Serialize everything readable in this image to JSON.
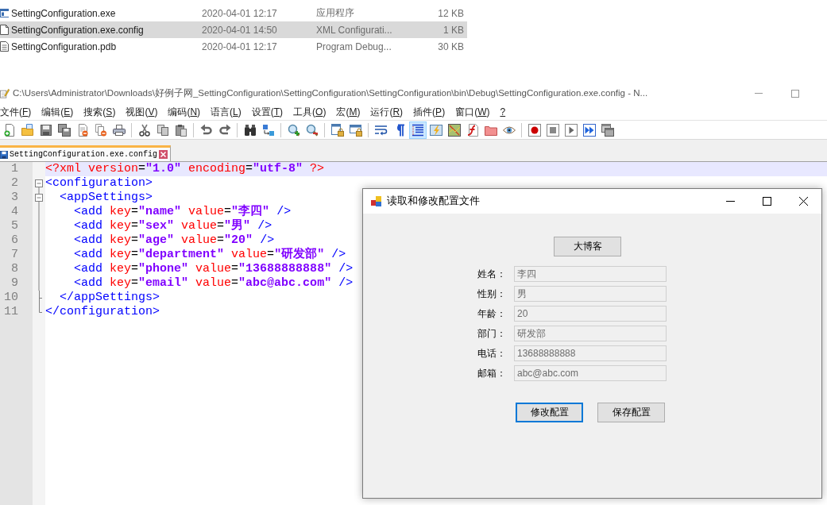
{
  "file_list": {
    "rows": [
      {
        "kind": "exe",
        "name": "SettingConfiguration.exe",
        "modified": "2020-04-01 12:17",
        "type": "应用程序",
        "size": "12 KB",
        "selected": false
      },
      {
        "kind": "config",
        "name": "SettingConfiguration.exe.config",
        "modified": "2020-04-01 14:50",
        "type": "XML Configurati...",
        "size": "1 KB",
        "selected": true
      },
      {
        "kind": "pdb",
        "name": "SettingConfiguration.pdb",
        "modified": "2020-04-01 12:17",
        "type": "Program Debug...",
        "size": "30 KB",
        "selected": false
      }
    ]
  },
  "editor_window": {
    "title": "C:\\Users\\Administrator\\Downloads\\好例子网_SettingConfiguration\\SettingConfiguration\\SettingConfiguration\\bin\\Debug\\SettingConfiguration.exe.config - N...",
    "menu": [
      "文件(F)",
      "编辑(E)",
      "搜索(S)",
      "视图(V)",
      "编码(N)",
      "语言(L)",
      "设置(T)",
      "工具(O)",
      "宏(M)",
      "运行(R)",
      "插件(P)",
      "窗口(W)",
      "?"
    ],
    "toolbar": [
      {
        "buttons": [
          {
            "selected": false
          },
          {
            "selected": false
          },
          {
            "selected": false
          },
          {
            "selected": false
          },
          {
            "selected": false
          },
          {
            "selected": false
          },
          {
            "selected": false
          }
        ]
      },
      {
        "buttons": [
          {
            "selected": false
          },
          {
            "selected": false
          },
          {
            "selected": false
          }
        ]
      },
      {
        "buttons": [
          {
            "selected": false
          },
          {
            "selected": false
          }
        ]
      },
      {
        "buttons": [
          {
            "selected": false
          },
          {
            "selected": false
          }
        ]
      },
      {
        "buttons": [
          {
            "selected": false
          },
          {
            "selected": false
          }
        ]
      },
      {
        "buttons": [
          {
            "selected": false
          },
          {
            "selected": false
          }
        ]
      },
      {
        "buttons": [
          {
            "selected": false
          },
          {
            "selected": false
          },
          {
            "selected": true
          },
          {
            "selected": false
          },
          {
            "selected": false
          },
          {
            "selected": false
          },
          {
            "selected": false
          },
          {
            "selected": false
          }
        ]
      },
      {
        "buttons": [
          {
            "selected": false
          },
          {
            "selected": false
          },
          {
            "selected": false
          },
          {
            "selected": false
          },
          {
            "selected": false
          }
        ]
      }
    ],
    "tabs": [
      {
        "label": "SettingConfiguration.exe.config",
        "selected": true,
        "modified": false
      }
    ],
    "lines": [
      {
        "number": "1",
        "current": true,
        "kind": "plain",
        "tokens": [
          {
            "kind": "pi",
            "text": "<?xml"
          },
          {
            "kind": "attr",
            "text": " version"
          },
          {
            "kind": "punct",
            "text": "="
          },
          {
            "kind": "value",
            "text": "\"1.0\""
          },
          {
            "kind": "attr",
            "text": " encoding"
          },
          {
            "kind": "punct",
            "text": "="
          },
          {
            "kind": "value",
            "text": "\"utf-8\""
          },
          {
            "kind": "pi",
            "text": " ?>"
          }
        ]
      },
      {
        "number": "2",
        "current": false,
        "kind": "head",
        "tokens": [
          {
            "kind": "tag",
            "text": "<configuration>"
          }
        ]
      },
      {
        "number": "3",
        "current": false,
        "kind": "subhead",
        "tokens": [
          {
            "kind": "tag",
            "text": "  <appSettings>"
          }
        ]
      },
      {
        "number": "4",
        "current": false,
        "kind": "body",
        "tokens": [
          {
            "kind": "tag",
            "text": "    <add"
          },
          {
            "kind": "attr",
            "text": " key"
          },
          {
            "kind": "punct",
            "text": "="
          },
          {
            "kind": "value",
            "text": "\"name\""
          },
          {
            "kind": "attr",
            "text": " value"
          },
          {
            "kind": "punct",
            "text": "="
          },
          {
            "kind": "value",
            "text": "\"李四\""
          },
          {
            "kind": "tag",
            "text": " />"
          }
        ]
      },
      {
        "number": "5",
        "current": false,
        "kind": "body",
        "tokens": [
          {
            "kind": "tag",
            "text": "    <add"
          },
          {
            "kind": "attr",
            "text": " key"
          },
          {
            "kind": "punct",
            "text": "="
          },
          {
            "kind": "value",
            "text": "\"sex\""
          },
          {
            "kind": "attr",
            "text": " value"
          },
          {
            "kind": "punct",
            "text": "="
          },
          {
            "kind": "value",
            "text": "\"男\""
          },
          {
            "kind": "tag",
            "text": " />"
          }
        ]
      },
      {
        "number": "6",
        "current": false,
        "kind": "body",
        "tokens": [
          {
            "kind": "tag",
            "text": "    <add"
          },
          {
            "kind": "attr",
            "text": " key"
          },
          {
            "kind": "punct",
            "text": "="
          },
          {
            "kind": "value",
            "text": "\"age\""
          },
          {
            "kind": "attr",
            "text": " value"
          },
          {
            "kind": "punct",
            "text": "="
          },
          {
            "kind": "value",
            "text": "\"20\""
          },
          {
            "kind": "tag",
            "text": " />"
          }
        ]
      },
      {
        "number": "7",
        "current": false,
        "kind": "body",
        "tokens": [
          {
            "kind": "tag",
            "text": "    <add"
          },
          {
            "kind": "attr",
            "text": " key"
          },
          {
            "kind": "punct",
            "text": "="
          },
          {
            "kind": "value",
            "text": "\"department\""
          },
          {
            "kind": "attr",
            "text": " value"
          },
          {
            "kind": "punct",
            "text": "="
          },
          {
            "kind": "value",
            "text": "\"研发部\""
          },
          {
            "kind": "tag",
            "text": " />"
          }
        ]
      },
      {
        "number": "8",
        "current": false,
        "kind": "body",
        "tokens": [
          {
            "kind": "tag",
            "text": "    <add"
          },
          {
            "kind": "attr",
            "text": " key"
          },
          {
            "kind": "punct",
            "text": "="
          },
          {
            "kind": "value",
            "text": "\"phone\""
          },
          {
            "kind": "attr",
            "text": " value"
          },
          {
            "kind": "punct",
            "text": "="
          },
          {
            "kind": "value",
            "text": "\"13688888888\""
          },
          {
            "kind": "tag",
            "text": " />"
          }
        ]
      },
      {
        "number": "9",
        "current": false,
        "kind": "body",
        "tokens": [
          {
            "kind": "tag",
            "text": "    <add"
          },
          {
            "kind": "attr",
            "text": " key"
          },
          {
            "kind": "punct",
            "text": "="
          },
          {
            "kind": "value",
            "text": "\"email\""
          },
          {
            "kind": "attr",
            "text": " value"
          },
          {
            "kind": "punct",
            "text": "="
          },
          {
            "kind": "value",
            "text": "\"abc@abc.com\""
          },
          {
            "kind": "tag",
            "text": " />"
          }
        ]
      },
      {
        "number": "10",
        "current": false,
        "kind": "subtail",
        "tokens": [
          {
            "kind": "tag",
            "text": "  </appSettings>"
          }
        ]
      },
      {
        "number": "11",
        "current": false,
        "kind": "tail",
        "tokens": [
          {
            "kind": "tag",
            "text": "</configuration>"
          }
        ]
      }
    ]
  },
  "dialog": {
    "title": "读取和修改配置文件",
    "top_button": "大博客",
    "fields": [
      {
        "label": "姓名：",
        "value": "李四",
        "disabled": true
      },
      {
        "label": "性别：",
        "value": "男",
        "disabled": true
      },
      {
        "label": "年龄：",
        "value": "20",
        "disabled": true
      },
      {
        "label": "部门：",
        "value": "研发部",
        "disabled": true
      },
      {
        "label": "电话：",
        "value": "13688888888",
        "disabled": true
      },
      {
        "label": "邮箱：",
        "value": "abc@abc.com",
        "disabled": true
      }
    ],
    "buttons": [
      {
        "label": "修改配置",
        "focused": true
      },
      {
        "label": "保存配置",
        "focused": false
      }
    ]
  }
}
